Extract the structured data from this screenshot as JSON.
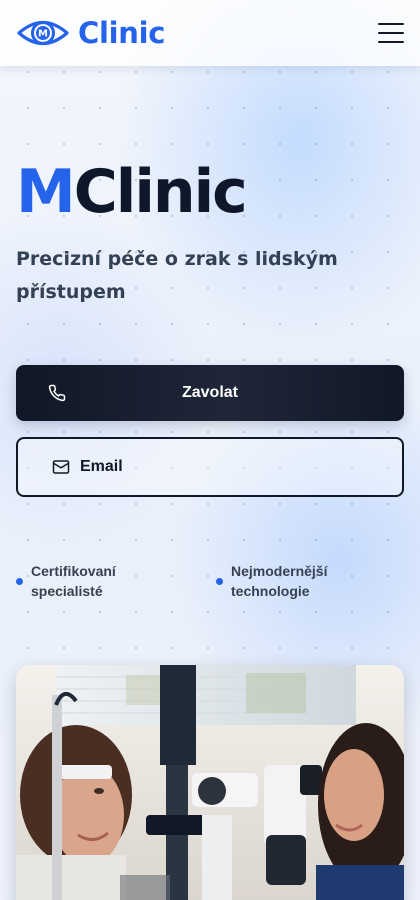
{
  "header": {
    "brand": "Clinic",
    "logo_letter": "M",
    "menu_icon": "hamburger-menu-icon"
  },
  "hero": {
    "title_accent": "M",
    "title_rest": "Clinic",
    "subtitle": "Precizní péče o zrak s lidským přístupem"
  },
  "buttons": {
    "call_label": "Zavolat",
    "call_icon": "phone-icon",
    "email_label": "Email",
    "email_icon": "envelope-icon"
  },
  "features": [
    {
      "label": "Certifikovaní specialisté"
    },
    {
      "label": "Nejmodernější technologie"
    }
  ],
  "image": {
    "subject": "eye-exam-photo"
  },
  "colors": {
    "accent": "#2563eb",
    "dark": "#111827",
    "background": "#eef3fb"
  }
}
